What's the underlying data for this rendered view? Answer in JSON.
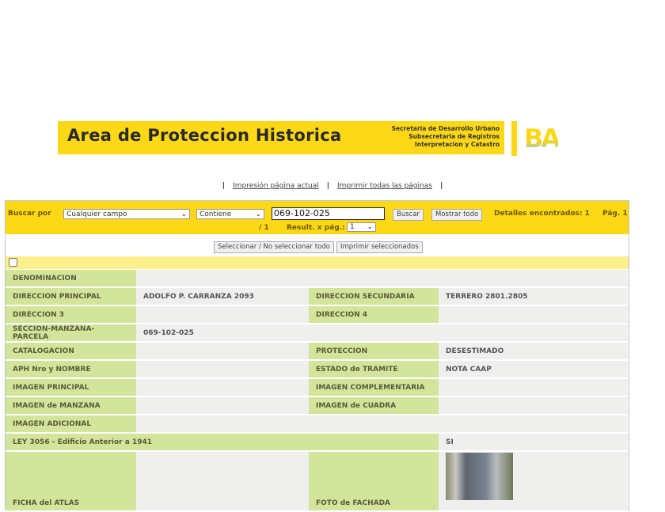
{
  "header": {
    "title": "Area de Proteccion Historica",
    "sub": [
      "Secretaria de Desarrollo Urbano",
      "Subsecretaria de Registros",
      "Interpretacion y Catastro"
    ],
    "logo": "BA"
  },
  "links": {
    "current": "Impresión página actual",
    "all": "Imprimir todas las páginas"
  },
  "search": {
    "label": "Buscar por",
    "field": "Cualquier campo",
    "op": "Contiene",
    "value": "069-102-025",
    "buscar": "Buscar",
    "mostrar": "Mostrar todo",
    "found": "Detalles encontrados: 1",
    "page": "Pág. 1",
    "of": "/ 1",
    "perpage_label": "Result. x pág.:",
    "perpage": "1"
  },
  "actions": {
    "select": "Seleccionar / No seleccionar todo",
    "print": "Imprimir seleccionados"
  },
  "rows": [
    {
      "l1": "DENOMINACION",
      "v1": ""
    },
    {
      "l1": "DIRECCION PRINCIPAL",
      "v1": "ADOLFO P. CARRANZA 2093",
      "l2": "DIRECCION SECUNDARIA",
      "v2": "TERRERO 2801.2805"
    },
    {
      "l1": "DIRECCION 3",
      "v1": "",
      "l2": "DIRECCION 4",
      "v2": ""
    },
    {
      "l1": "SECCION-MANZANA-PARCELA",
      "v1": "069-102-025"
    },
    {
      "l1": "CATALOGACION",
      "v1": "",
      "l2": "PROTECCION",
      "v2": "DESESTIMADO"
    },
    {
      "l1": "APH Nro y NOMBRE",
      "v1": "",
      "l2": "ESTADO de TRAMITE",
      "v2": "NOTA CAAP"
    },
    {
      "l1": "IMAGEN PRINCIPAL",
      "v1": "",
      "l2": "IMAGEN COMPLEMENTARIA",
      "v2": ""
    },
    {
      "l1": "IMAGEN de MANZANA",
      "v1": "",
      "l2": "IMAGEN de CUADRA",
      "v2": ""
    },
    {
      "l1": "IMAGEN ADICIONAL",
      "v1": ""
    },
    {
      "l1": "LEY 3056 - Edificio Anterior a 1941",
      "v1": "SI"
    },
    {
      "l1": "FICHA del ATLAS",
      "v1": "",
      "l2": "FOTO de FACHADA"
    }
  ]
}
